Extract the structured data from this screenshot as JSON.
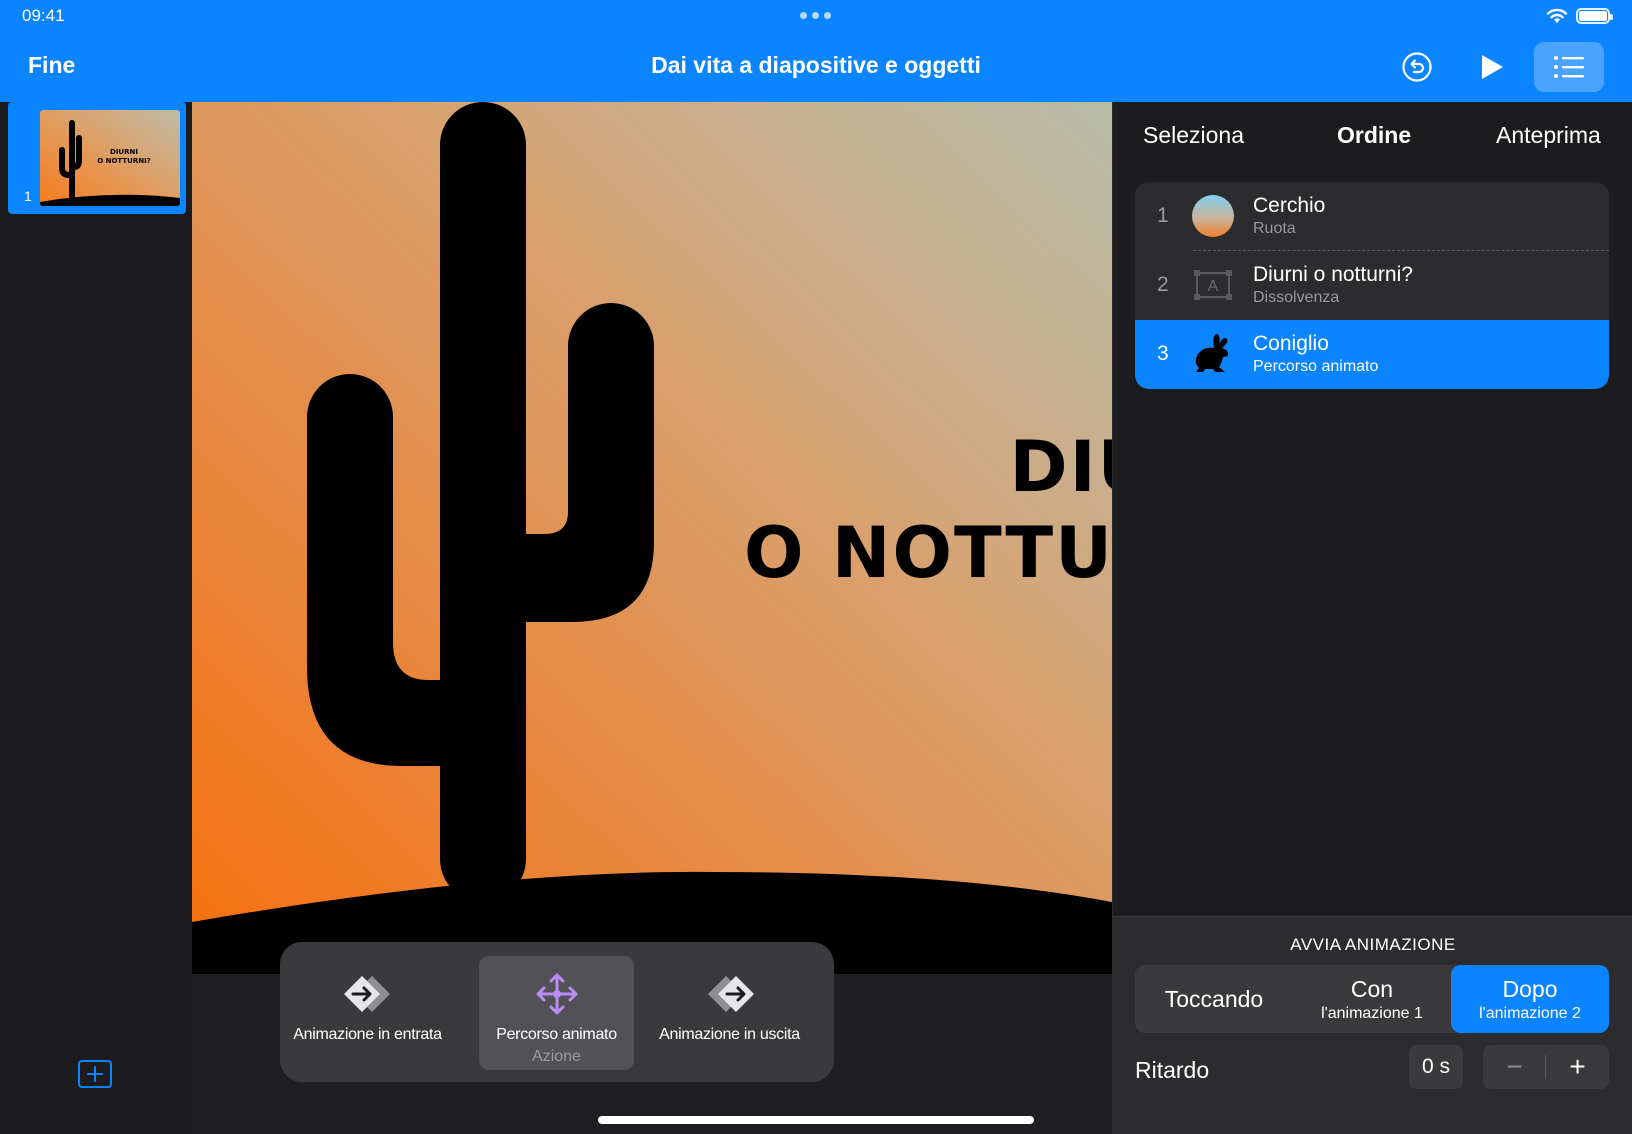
{
  "status": {
    "time": "09:41"
  },
  "toolbar": {
    "done_label": "Fine",
    "title": "Dai vita a diapositive e oggetti"
  },
  "navigator": {
    "slides": [
      {
        "number": "1",
        "title_line1": "DIURNI",
        "title_line2": "O NOTTURNI?"
      }
    ]
  },
  "slide": {
    "title_line1": "DIURNI",
    "title_line2": "O NOTTURNI?"
  },
  "animation_menu": {
    "options": [
      {
        "label": "Animazione in entrata",
        "sub": ""
      },
      {
        "label": "Percorso animato",
        "sub": "Azione"
      },
      {
        "label": "Animazione in uscita",
        "sub": ""
      }
    ],
    "selected_index": 1
  },
  "panel": {
    "tabs": [
      "Seleziona",
      "Ordine",
      "Anteprima"
    ],
    "active_tab": "Ordine",
    "order": [
      {
        "number": "1",
        "name": "Cerchio",
        "effect": "Ruota",
        "icon": "circle-icon"
      },
      {
        "number": "2",
        "name": "Diurni o notturni?",
        "effect": "Dissolvenza",
        "icon": "text-box-icon"
      },
      {
        "number": "3",
        "name": "Coniglio",
        "effect": "Percorso animato",
        "icon": "rabbit-icon"
      }
    ],
    "selected_order_index": 2,
    "start_label": "AVVIA ANIMAZIONE",
    "start_options": [
      {
        "main": "Toccando",
        "sub": ""
      },
      {
        "main": "Con",
        "sub": "l'animazione 1"
      },
      {
        "main": "Dopo",
        "sub": "l'animazione 2"
      }
    ],
    "selected_start_index": 2,
    "delay_label": "Ritardo",
    "delay_value": "0 s",
    "stepper_minus": "−",
    "stepper_plus": "+"
  },
  "colors": {
    "accent": "#0a84ff",
    "panel_bg": "#1c1c1e",
    "slide_gradient_start": "#f76f0c",
    "slide_gradient_end": "#b7bca6"
  }
}
